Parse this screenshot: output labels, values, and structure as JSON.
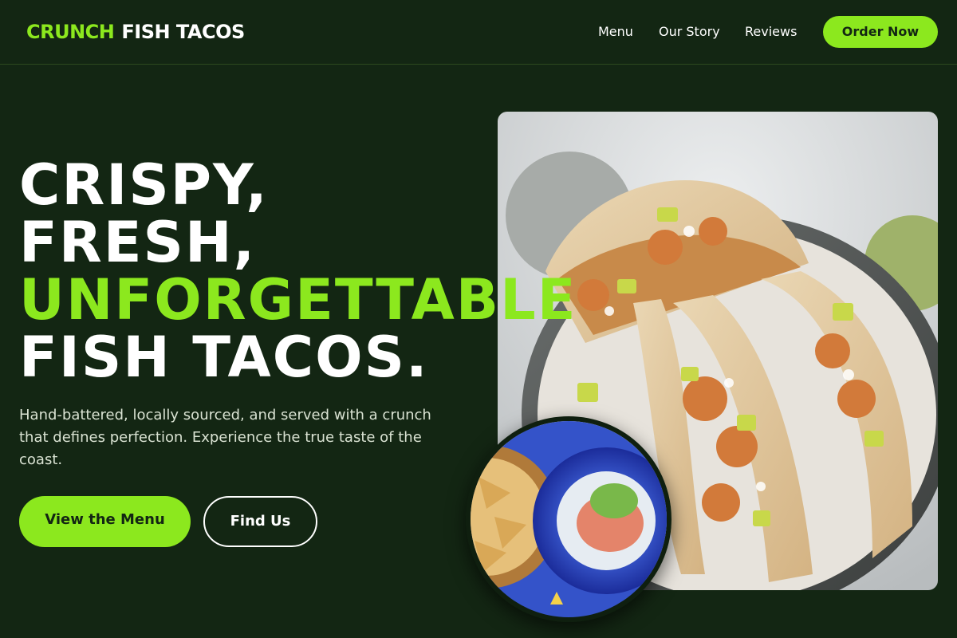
{
  "header": {
    "logo_part1": "CRUNCH",
    "logo_part2": "FISH TACOS",
    "nav": [
      "Menu",
      "Our Story",
      "Reviews"
    ],
    "order_label": "Order Now"
  },
  "hero": {
    "headline_line1": "CRISPY,",
    "headline_line2": "FRESH,",
    "headline_accent": "UNFORGETTABLE",
    "headline_line4": "FISH TACOS.",
    "subtext": "Hand-battered, locally sourced, and served with a crunch that defines perfection. Experience the true taste of the coast.",
    "primary_cta": "View the Menu",
    "secondary_cta": "Find Us"
  },
  "colors": {
    "background": "#132613",
    "accent": "#8ce81e",
    "text": "#ffffff"
  }
}
